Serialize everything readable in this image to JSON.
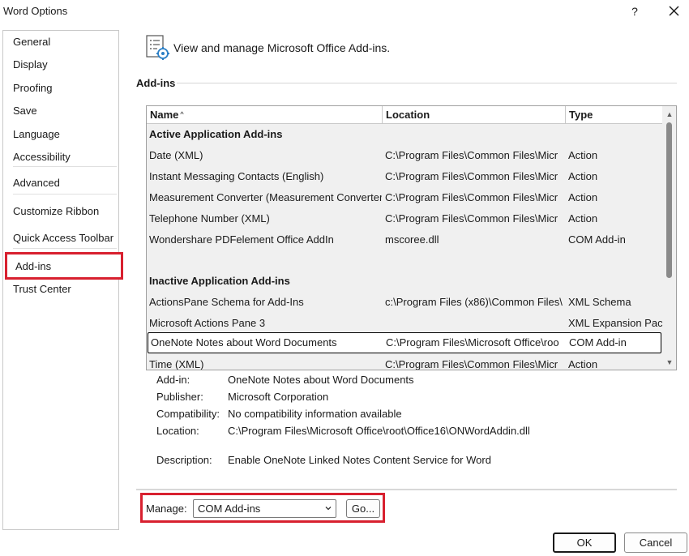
{
  "window": {
    "title": "Word Options",
    "help_label": "?"
  },
  "sidebar": {
    "items": [
      {
        "label": "General"
      },
      {
        "label": "Display"
      },
      {
        "label": "Proofing"
      },
      {
        "label": "Save"
      },
      {
        "label": "Language"
      },
      {
        "label": "Accessibility"
      },
      {
        "label": "Advanced"
      },
      {
        "label": "Customize Ribbon"
      },
      {
        "label": "Quick Access Toolbar"
      },
      {
        "label": "Add-ins"
      },
      {
        "label": "Trust Center"
      }
    ],
    "selected": "Add-ins"
  },
  "header": {
    "text": "View and manage Microsoft Office Add-ins."
  },
  "section": {
    "title": "Add-ins"
  },
  "table": {
    "columns": {
      "name": "Name",
      "location": "Location",
      "type": "Type"
    },
    "groups": {
      "active": "Active Application Add-ins",
      "inactive": "Inactive Application Add-ins"
    },
    "active_rows": [
      {
        "name": "Date (XML)",
        "location": "C:\\Program Files\\Common Files\\Micr",
        "type": "Action"
      },
      {
        "name": "Instant Messaging Contacts (English)",
        "location": "C:\\Program Files\\Common Files\\Micr",
        "type": "Action"
      },
      {
        "name": "Measurement Converter (Measurement Converter)",
        "location": "C:\\Program Files\\Common Files\\Micr",
        "type": "Action"
      },
      {
        "name": "Telephone Number (XML)",
        "location": "C:\\Program Files\\Common Files\\Micr",
        "type": "Action"
      },
      {
        "name": "Wondershare PDFelement Office AddIn",
        "location": "mscoree.dll",
        "type": "COM Add-in"
      }
    ],
    "inactive_rows": [
      {
        "name": "ActionsPane Schema for Add-Ins",
        "location": "c:\\Program Files (x86)\\Common Files\\",
        "type": "XML Schema"
      },
      {
        "name": "Microsoft Actions Pane 3",
        "location": "",
        "type": "XML Expansion Pack"
      },
      {
        "name": "OneNote Notes about Word Documents",
        "location": "C:\\Program Files\\Microsoft Office\\roo",
        "type": "COM Add-in"
      },
      {
        "name": "Time (XML)",
        "location": "C:\\Program Files\\Common Files\\Micr",
        "type": "Action"
      }
    ]
  },
  "details": {
    "addin_label": "Add-in:",
    "addin_value": "OneNote Notes about Word Documents",
    "publisher_label": "Publisher:",
    "publisher_value": "Microsoft Corporation",
    "compat_label": "Compatibility:",
    "compat_value": "No compatibility information available",
    "location_label": "Location:",
    "location_value": "C:\\Program Files\\Microsoft Office\\root\\Office16\\ONWordAddin.dll",
    "description_label": "Description:",
    "description_value": "Enable OneNote Linked Notes Content Service for Word"
  },
  "manage": {
    "label": "Manage:",
    "selected": "COM Add-ins",
    "go_label": "Go..."
  },
  "footer": {
    "ok_label": "OK",
    "cancel_label": "Cancel"
  },
  "colors": {
    "highlight_border": "#d8202f",
    "grid_bg": "#f0f0f0",
    "scroll_thumb": "#8a8a8a"
  }
}
